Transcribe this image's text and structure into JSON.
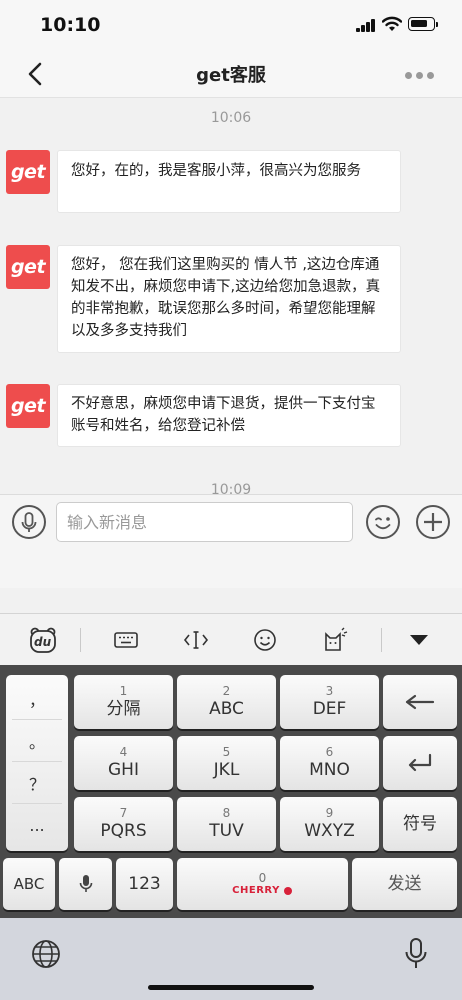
{
  "status_bar": {
    "time": "10:10"
  },
  "nav": {
    "title": "get客服"
  },
  "chat": {
    "avatar_text": "get",
    "timestamps": [
      "10:06",
      "10:09"
    ],
    "messages": [
      {
        "sender": "get",
        "text": "您好，在的，我是客服小萍，很高兴为您服务"
      },
      {
        "sender": "get",
        "text": "您好， 您在我们这里购买的 情人节 ,这边仓库通知发不出，麻烦您申请下,这边给您加急退款，真的非常抱歉，耽误您那么多时间，希望您能理解以及多多支持我们"
      },
      {
        "sender": "get",
        "text": "不好意思，麻烦您申请下退货，提供一下支付宝账号和姓名，给您登记补偿"
      }
    ]
  },
  "input": {
    "placeholder": "输入新消息"
  },
  "keyboard": {
    "toolbar_logo": "du",
    "punctuation": [
      "，",
      "。",
      "？",
      "..."
    ],
    "rows": [
      [
        {
          "num": "1",
          "letters": "分隔"
        },
        {
          "num": "2",
          "letters": "ABC"
        },
        {
          "num": "3",
          "letters": "DEF"
        }
      ],
      [
        {
          "num": "4",
          "letters": "GHI"
        },
        {
          "num": "5",
          "letters": "JKL"
        },
        {
          "num": "6",
          "letters": "MNO"
        }
      ],
      [
        {
          "num": "7",
          "letters": "PQRS"
        },
        {
          "num": "8",
          "letters": "TUV"
        },
        {
          "num": "9",
          "letters": "WXYZ"
        }
      ]
    ],
    "symbol_label": "符号",
    "abc_label": "ABC",
    "num_mode_label": "123",
    "space_num": "0",
    "space_brand": "CHERRY",
    "send_label": "发送"
  }
}
